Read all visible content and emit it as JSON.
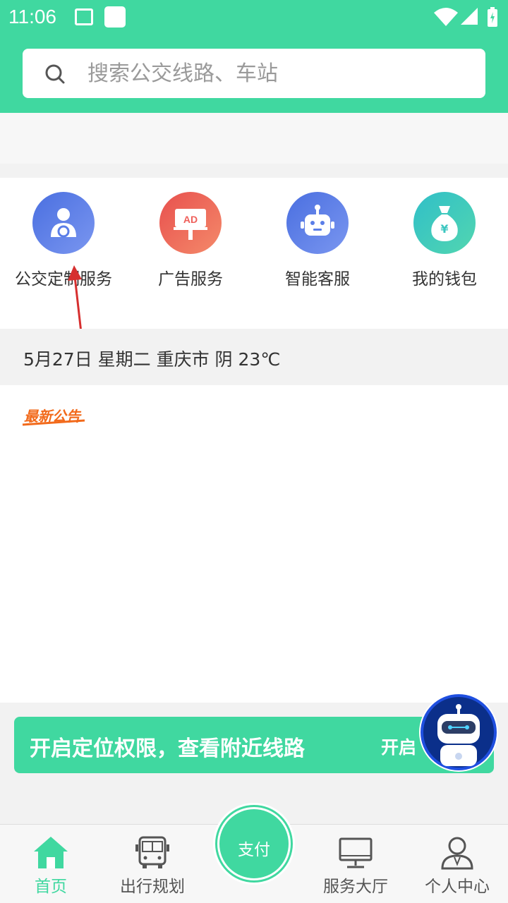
{
  "status_bar": {
    "time": "11:06"
  },
  "search": {
    "placeholder": "搜索公交线路、车站"
  },
  "services": [
    {
      "label": "公交定制服务",
      "icon": "driver-icon",
      "color": "#5b7ee8"
    },
    {
      "label": "广告服务",
      "icon": "ad-icon",
      "color": "#ef5f5a"
    },
    {
      "label": "智能客服",
      "icon": "robot-icon",
      "color": "#5b7ee8"
    },
    {
      "label": "我的钱包",
      "icon": "money-bag-icon",
      "color": "#3cc6c0"
    }
  ],
  "weather": {
    "text": "5月27日 星期二 重庆市 阴 23℃"
  },
  "notice": {
    "title": "最新公告"
  },
  "location_prompt": {
    "text": "开启定位权限，查看附近线路",
    "button": "开启"
  },
  "tabbar": {
    "items": [
      {
        "label": "首页",
        "icon": "home-icon"
      },
      {
        "label": "出行规划",
        "icon": "bus-icon"
      },
      {
        "label": "服务大厅",
        "icon": "monitor-icon"
      },
      {
        "label": "个人中心",
        "icon": "person-icon"
      }
    ],
    "pay_label": "支付"
  },
  "colors": {
    "brand": "#40d8a0",
    "notice": "#f26a1b"
  }
}
